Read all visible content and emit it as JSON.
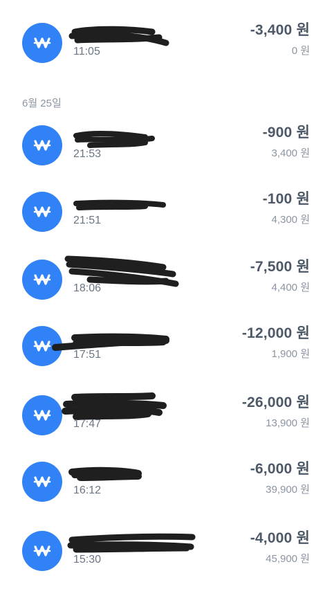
{
  "colors": {
    "accent": "#3182f6",
    "amount_text": "#4e5968",
    "secondary_text": "#8b95a1",
    "redaction": "#1f1f1f"
  },
  "icon_name": "won-currency-icon",
  "transactions_top": [
    {
      "time": "11:05",
      "amount": "-3,400 원",
      "balance": "0 원"
    }
  ],
  "date_header": "6월 25일",
  "transactions": [
    {
      "time": "21:53",
      "amount": "-900 원",
      "balance": "3,400 원"
    },
    {
      "time": "21:51",
      "amount": "-100 원",
      "balance": "4,300 원"
    },
    {
      "time": "18:06",
      "amount": "-7,500 원",
      "balance": "4,400 원"
    },
    {
      "time": "17:51",
      "amount": "-12,000 원",
      "balance": "1,900 원"
    },
    {
      "time": "17:47",
      "amount": "-26,000 원",
      "balance": "13,900 원"
    },
    {
      "time": "16:12",
      "amount": "-6,000 원",
      "balance": "39,900 원"
    },
    {
      "time": "15:30",
      "amount": "-4,000 원",
      "balance": "45,900 원"
    }
  ]
}
